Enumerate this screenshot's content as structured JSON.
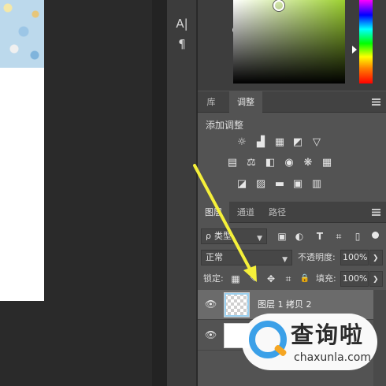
{
  "toolstrip": {
    "character_icon": "A|",
    "paragraph_icon": "¶"
  },
  "adjust_panel": {
    "tabs": [
      {
        "label": "库",
        "active": false
      },
      {
        "label": "调整",
        "active": true
      }
    ],
    "title": "添加调整",
    "icon_rows": [
      [
        "brightness-contrast-icon",
        "levels-icon",
        "curves-icon",
        "exposure-icon",
        "vibrance-icon"
      ],
      [
        "hue-saturation-icon",
        "color-balance-icon",
        "black-white-icon",
        "photo-filter-icon",
        "channel-mixer-icon",
        "color-lookup-icon"
      ],
      [
        "invert-icon",
        "posterize-icon",
        "threshold-icon",
        "selective-color-icon",
        "gradient-map-icon"
      ]
    ],
    "icon_glyphs": [
      [
        "☼",
        "▟",
        "▦",
        "◩",
        "▽"
      ],
      [
        "▤",
        "⚖",
        "◧",
        "◉",
        "❋",
        "▦"
      ],
      [
        "◪",
        "▨",
        "▬",
        "▣",
        "▥"
      ]
    ]
  },
  "layers_panel": {
    "tabs": [
      {
        "label": "图层",
        "active": true
      },
      {
        "label": "通道",
        "active": false
      },
      {
        "label": "路径",
        "active": false
      }
    ],
    "filter": {
      "search_glyph": "ρ",
      "kind_label": "类型",
      "filter_icon_glyphs": [
        "▣",
        "◐",
        "T",
        "⌗",
        "▯"
      ]
    },
    "blend_mode": "正常",
    "opacity_label": "不透明度:",
    "opacity_value": "100%",
    "lock_label": "锁定:",
    "lock_icon_glyphs": [
      "▦",
      "✎",
      "✥",
      "⌗",
      "🔒"
    ],
    "fill_label": "填充:",
    "fill_value": "100%",
    "layers": [
      {
        "name": "图层 1 拷贝 2",
        "visible": true,
        "selected": true,
        "thumbnail": "transparent"
      },
      {
        "name": "",
        "visible": true,
        "selected": false,
        "thumbnail": "white"
      }
    ]
  },
  "watermark": {
    "cn_text": "查询啦",
    "en_text": "chaxunla.com"
  },
  "colors": {
    "panel_bg": "#535353",
    "arrow": "#f5f03a",
    "hue_top": "#ff00ff",
    "sv_color": "#9bcf2f"
  }
}
